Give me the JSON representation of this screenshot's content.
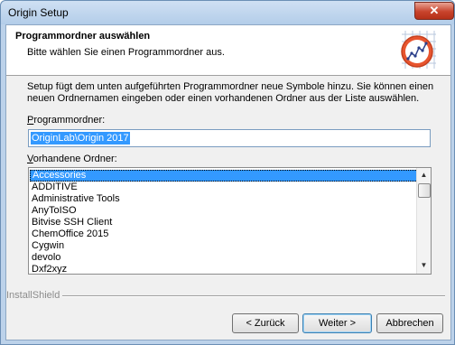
{
  "window": {
    "title": "Origin Setup",
    "close_glyph": "✕"
  },
  "header": {
    "title": "Programmordner auswählen",
    "subtitle": "Bitte wählen Sie einen Programmordner aus."
  },
  "description_line1": "Setup fügt dem unten aufgeführten Programmordner neue Symbole hinzu. Sie können einen",
  "description_line2": "neuen Ordnernamen eingeben oder einen vorhandenen Ordner aus der Liste auswählen.",
  "program_folder": {
    "label_accel": "P",
    "label_rest": "rogrammordner:",
    "value": "OriginLab\\Origin 2017"
  },
  "existing_folders": {
    "label_accel": "V",
    "label_rest": "orhandene Ordner:",
    "items": [
      "Accessories",
      "ADDITIVE",
      "Administrative Tools",
      "AnyToISO",
      "Bitvise SSH Client",
      "ChemOffice 2015",
      "Cygwin",
      "devolo",
      "Dxf2xyz"
    ],
    "selected_index": 0
  },
  "scrollbar": {
    "up_glyph": "▲",
    "down_glyph": "▼"
  },
  "installshield_label": "InstallShield",
  "buttons": {
    "back": "< Zurück",
    "next": "Weiter >",
    "cancel": "Abbrechen"
  },
  "icons": {
    "logo": "origin-graph-logo-icon"
  }
}
